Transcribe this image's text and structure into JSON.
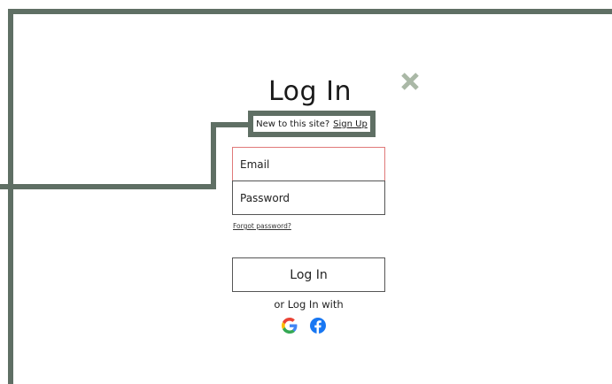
{
  "login": {
    "title": "Log In",
    "signup_prompt": "New to this site?",
    "signup_link": "Sign Up",
    "email_placeholder": "Email",
    "password_placeholder": "Password",
    "forgot_password": "Forgot password?",
    "submit_label": "Log In",
    "social_prompt": "or Log In with",
    "social_icons": [
      "google-icon",
      "facebook-icon"
    ]
  },
  "colors": {
    "accent_green": "#5f6f64",
    "close_icon": "#aab8a6",
    "error_border": "#e07a7a",
    "google_blue": "#4285F4",
    "google_red": "#EA4335",
    "google_yellow": "#FBBC05",
    "google_green": "#34A853",
    "facebook_blue": "#1877F2"
  }
}
